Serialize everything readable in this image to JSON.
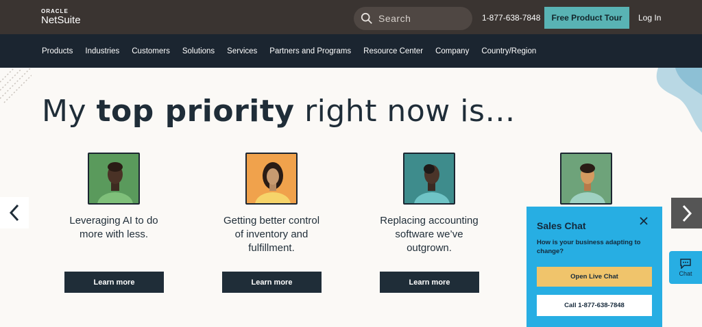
{
  "header": {
    "logo_oracle": "ORACLE",
    "logo_netsuite": "NetSuite",
    "search_placeholder": "Search",
    "phone": "1-877-638-7848",
    "tour_button": "Free Product Tour",
    "login": "Log In"
  },
  "nav": {
    "items": [
      "Products",
      "Industries",
      "Customers",
      "Solutions",
      "Services",
      "Partners and Programs",
      "Resource Center",
      "Company",
      "Country/Region"
    ]
  },
  "hero": {
    "title_pre": "My ",
    "title_bold": "top priority",
    "title_post": " right now is…"
  },
  "cards": [
    {
      "text": "Leveraging AI to do more with less.",
      "button": "Learn more"
    },
    {
      "text": "Getting better control of inventory and fulfillment.",
      "button": "Learn more"
    },
    {
      "text": "Replacing accounting software we’ve outgrown.",
      "button": "Learn more"
    }
  ],
  "sales_chat": {
    "title": "Sales Chat",
    "question": "How is your business adapting to change?",
    "live_button": "Open Live Chat",
    "call_button": "Call 1-877-638-7848"
  },
  "chat_tab": {
    "label": "Chat"
  },
  "colors": {
    "topbar": "#3a3431",
    "navbar": "#1b2530",
    "accent_teal": "#59b3b4",
    "chat_blue": "#27aee3",
    "live_chat_yellow": "#f0c46b"
  },
  "icons": [
    "search-icon",
    "chevron-left-icon",
    "chevron-right-icon",
    "close-icon",
    "chat-bubble-icon"
  ]
}
